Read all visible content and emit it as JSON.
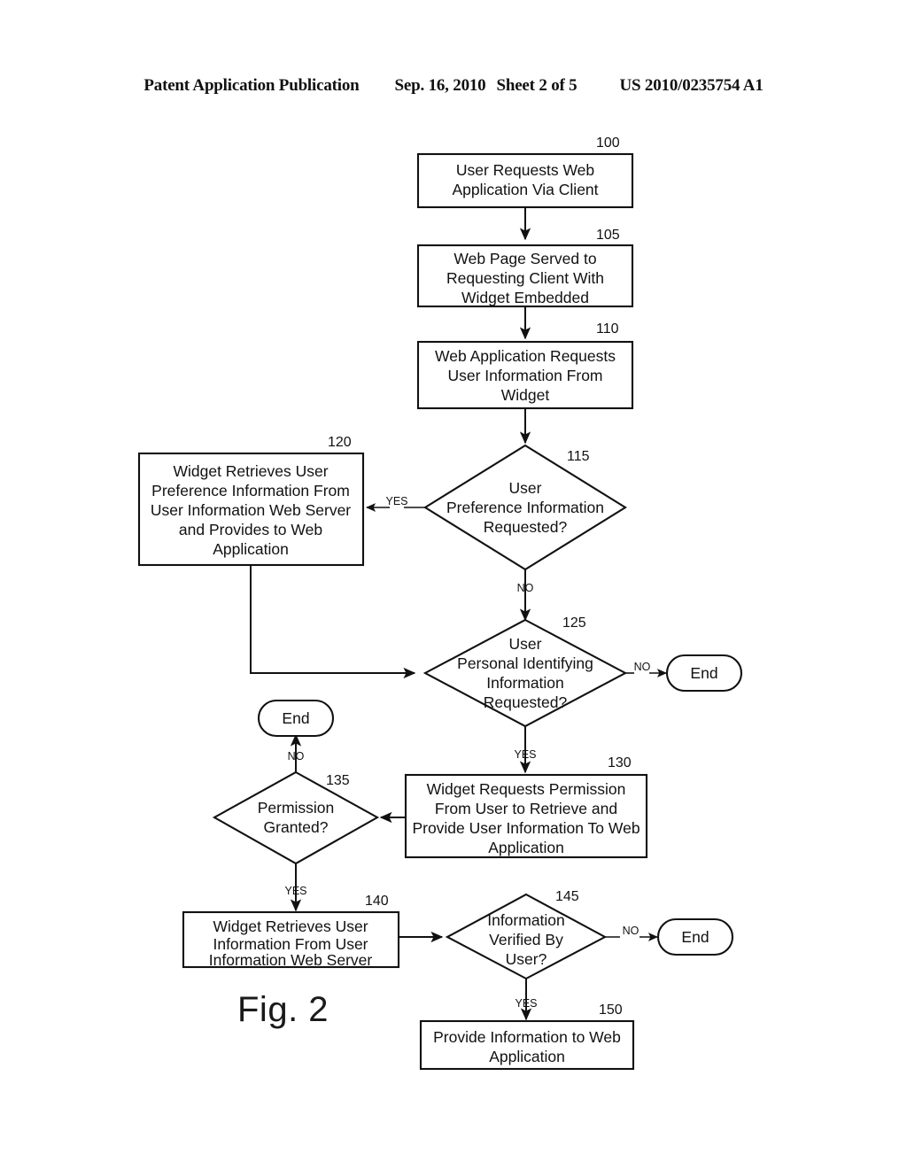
{
  "header": {
    "publication": "Patent Application Publication",
    "date": "Sep. 16, 2010",
    "sheet": "Sheet 2 of 5",
    "pub_number": "US 2010/0235754 A1"
  },
  "figure": {
    "label": "Fig. 2"
  },
  "colors": {
    "ink": "#111111",
    "page": "#ffffff"
  },
  "chart_data": {
    "type": "flowchart",
    "title": "Fig. 2",
    "nodes": [
      {
        "ref": "100",
        "shape": "process",
        "text": "User Requests Web Application Via Client"
      },
      {
        "ref": "105",
        "shape": "process",
        "text": "Web Page Served to Requesting Client With Widget Embedded"
      },
      {
        "ref": "110",
        "shape": "process",
        "text": "Web Application Requests User Information From Widget"
      },
      {
        "ref": "115",
        "shape": "decision",
        "text": "User Preference Information Requested?"
      },
      {
        "ref": "120",
        "shape": "process",
        "text": "Widget Retrieves User Preference Information From User Information Web Server and Provides to Web Application"
      },
      {
        "ref": "125",
        "shape": "decision",
        "text": "User Personal Identifying Information Requested?"
      },
      {
        "ref": "130",
        "shape": "process",
        "text": "Widget Requests Permission From User to Retrieve and Provide User Information To Web Application"
      },
      {
        "ref": "135",
        "shape": "decision",
        "text": "Permission Granted?"
      },
      {
        "ref": "140",
        "shape": "process",
        "text": "Widget Retrieves User Information From User Information Web Server"
      },
      {
        "ref": "145",
        "shape": "decision",
        "text": "Information Verified By User?"
      },
      {
        "ref": "150",
        "shape": "process",
        "text": "Provide Information to Web Application"
      },
      {
        "ref": "end-125",
        "shape": "terminator",
        "text": "End"
      },
      {
        "ref": "end-135",
        "shape": "terminator",
        "text": "End"
      },
      {
        "ref": "end-145",
        "shape": "terminator",
        "text": "End"
      }
    ],
    "edges": [
      {
        "from": "100",
        "to": "105",
        "label": ""
      },
      {
        "from": "105",
        "to": "110",
        "label": ""
      },
      {
        "from": "110",
        "to": "115",
        "label": ""
      },
      {
        "from": "115",
        "to": "120",
        "label": "YES"
      },
      {
        "from": "115",
        "to": "125",
        "label": "NO"
      },
      {
        "from": "120",
        "to": "125",
        "label": ""
      },
      {
        "from": "125",
        "to": "end-125",
        "label": "NO"
      },
      {
        "from": "125",
        "to": "130",
        "label": "YES"
      },
      {
        "from": "130",
        "to": "135",
        "label": ""
      },
      {
        "from": "135",
        "to": "end-135",
        "label": "NO"
      },
      {
        "from": "135",
        "to": "140",
        "label": "YES"
      },
      {
        "from": "140",
        "to": "145",
        "label": ""
      },
      {
        "from": "145",
        "to": "end-145",
        "label": "NO"
      },
      {
        "from": "145",
        "to": "150",
        "label": "YES"
      }
    ]
  },
  "nodes": {
    "n100": {
      "ref": "100",
      "line1": "User Requests Web",
      "line2": "Application Via Client"
    },
    "n105": {
      "ref": "105",
      "line1": "Web Page Served to",
      "line2": "Requesting Client With",
      "line3": "Widget Embedded"
    },
    "n110": {
      "ref": "110",
      "line1": "Web Application Requests",
      "line2": "User Information From",
      "line3": "Widget"
    },
    "n115": {
      "ref": "115",
      "line1": "User",
      "line2": "Preference Information",
      "line3": "Requested?"
    },
    "n120": {
      "ref": "120",
      "line1": "Widget Retrieves User",
      "line2": "Preference Information From",
      "line3": "User Information Web Server",
      "line4": "and Provides to Web",
      "line5": "Application"
    },
    "n125": {
      "ref": "125",
      "line1": "User",
      "line2": "Personal Identifying",
      "line3": "Information",
      "line4": "Requested?"
    },
    "n130": {
      "ref": "130",
      "line1": "Widget Requests Permission",
      "line2": "From User to Retrieve and",
      "line3": "Provide User Information To Web",
      "line4": "Application"
    },
    "n135": {
      "ref": "135",
      "line1": "Permission",
      "line2": "Granted?"
    },
    "n140": {
      "ref": "140",
      "line1": "Widget Retrieves User",
      "line2": "Information From User",
      "line3": "Information Web Server"
    },
    "n145": {
      "ref": "145",
      "line1": "Information",
      "line2": "Verified By",
      "line3": "User?"
    },
    "n150": {
      "ref": "150",
      "line1": "Provide Information to Web",
      "line2": "Application"
    },
    "end1": {
      "text": "End"
    },
    "end2": {
      "text": "End"
    },
    "end3": {
      "text": "End"
    }
  },
  "edge_labels": {
    "yes_115": "YES",
    "no_115": "NO",
    "no_125": "NO",
    "yes_125": "YES",
    "no_135": "NO",
    "yes_135": "YES",
    "no_145": "NO",
    "yes_145": "YES"
  }
}
